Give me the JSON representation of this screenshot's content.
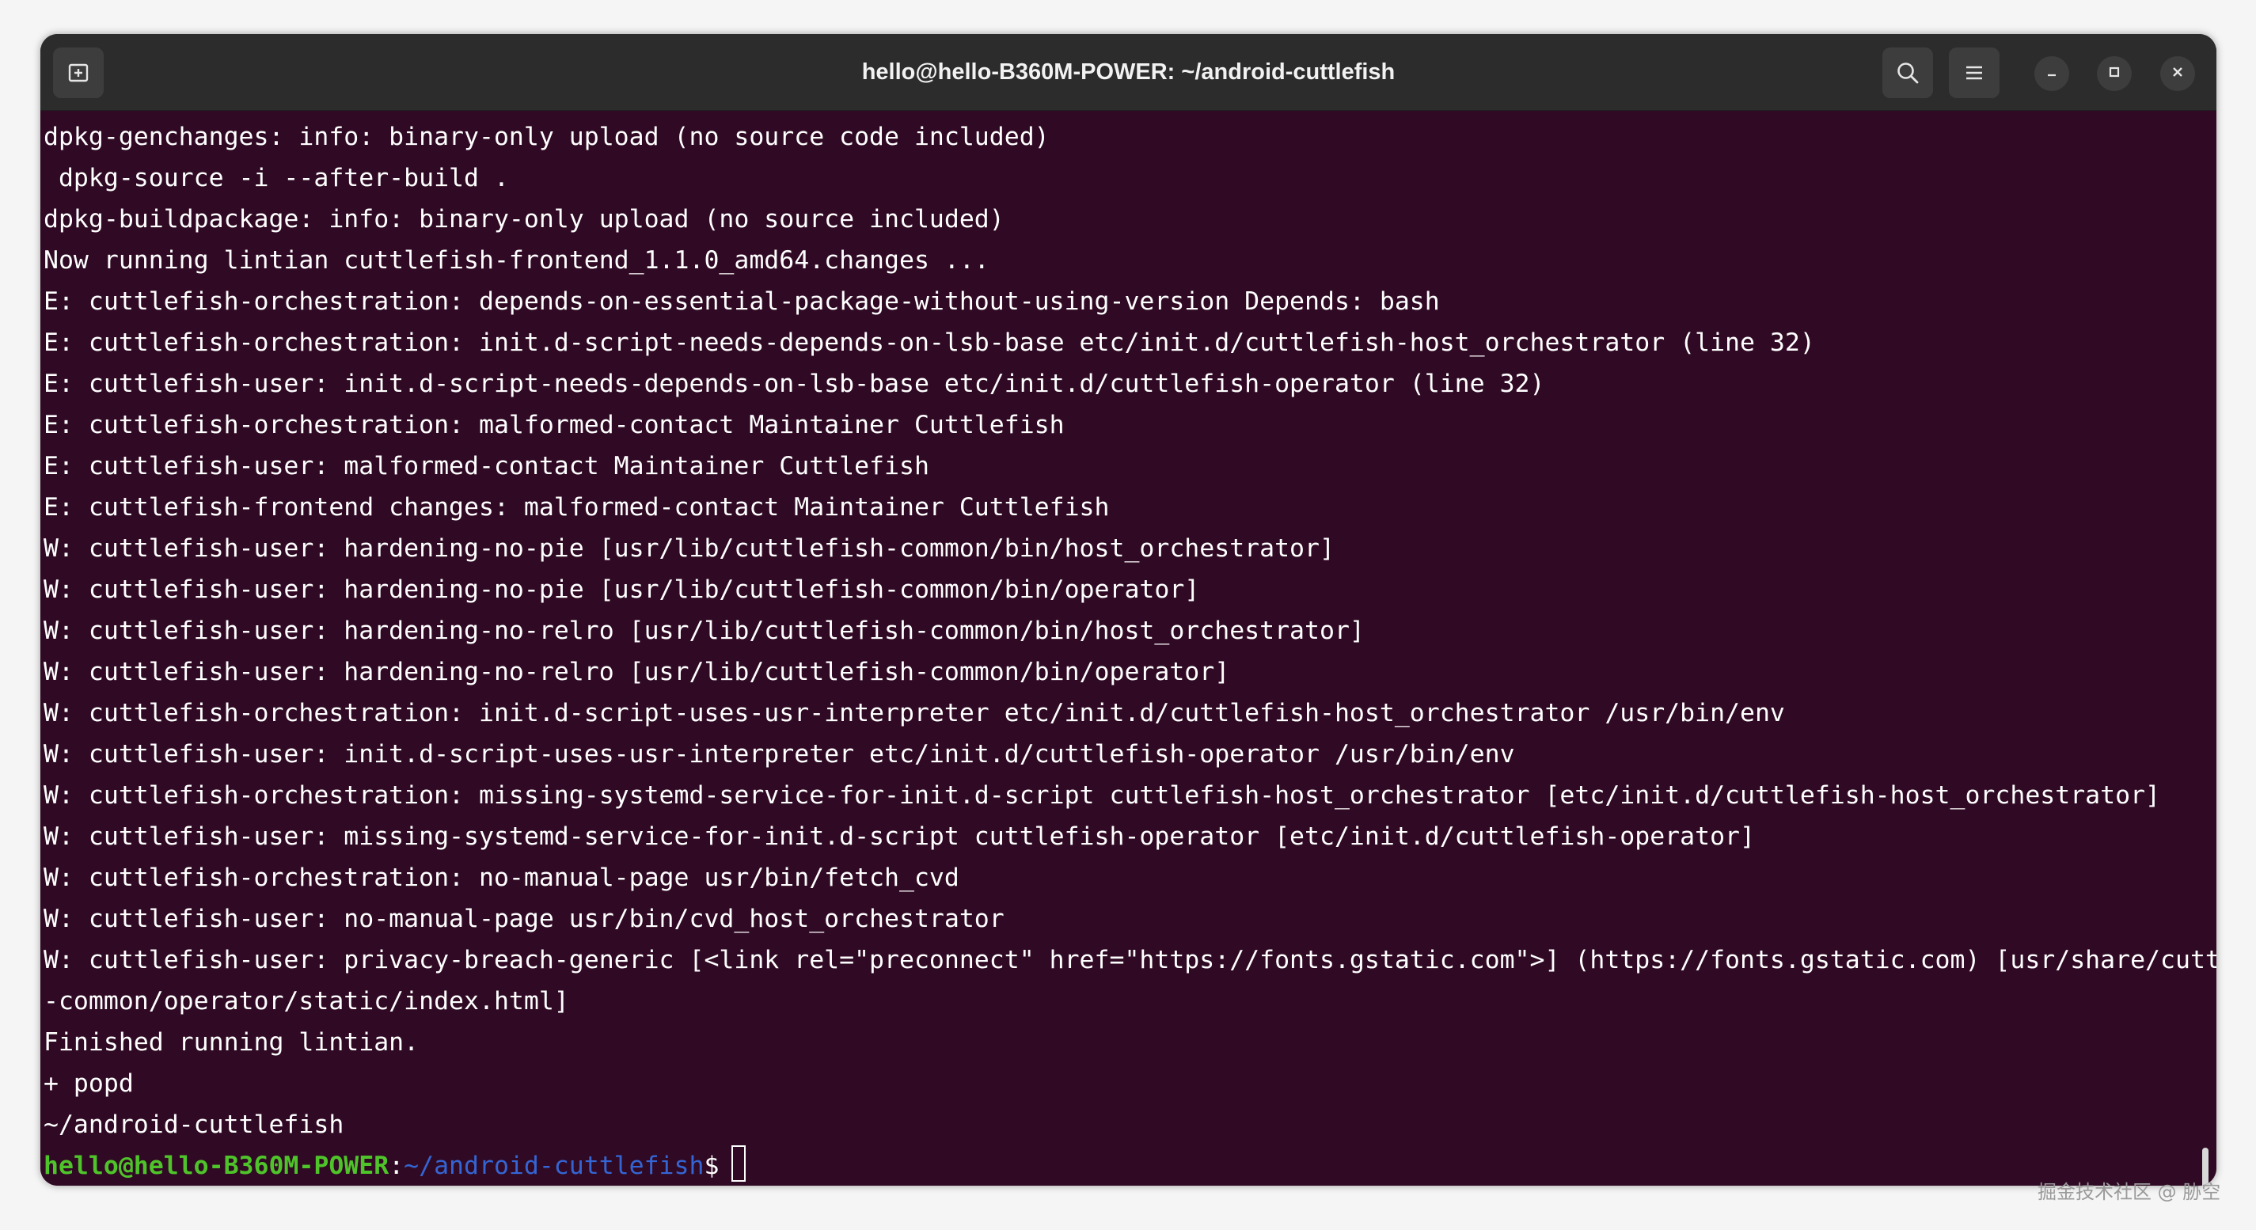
{
  "window": {
    "title": "hello@hello-B360M-POWER: ~/android-cuttlefish"
  },
  "titlebar": {
    "icons": {
      "new_tab": "new-tab-icon",
      "search": "search-icon",
      "menu": "hamburger-menu-icon",
      "minimize": "minimize-icon",
      "maximize": "maximize-icon",
      "close": "close-icon"
    }
  },
  "terminal": {
    "colors": {
      "background": "#300a24",
      "foreground": "#ffffff",
      "prompt_user": "#4fc42a",
      "prompt_path": "#3465d4"
    },
    "lines": [
      "dpkg-genchanges: info: binary-only upload (no source code included)",
      " dpkg-source -i --after-build .",
      "dpkg-buildpackage: info: binary-only upload (no source included)",
      "Now running lintian cuttlefish-frontend_1.1.0_amd64.changes ...",
      "E: cuttlefish-orchestration: depends-on-essential-package-without-using-version Depends: bash",
      "E: cuttlefish-orchestration: init.d-script-needs-depends-on-lsb-base etc/init.d/cuttlefish-host_orchestrator (line 32)",
      "E: cuttlefish-user: init.d-script-needs-depends-on-lsb-base etc/init.d/cuttlefish-operator (line 32)",
      "E: cuttlefish-orchestration: malformed-contact Maintainer Cuttlefish",
      "E: cuttlefish-user: malformed-contact Maintainer Cuttlefish",
      "E: cuttlefish-frontend changes: malformed-contact Maintainer Cuttlefish",
      "W: cuttlefish-user: hardening-no-pie [usr/lib/cuttlefish-common/bin/host_orchestrator]",
      "W: cuttlefish-user: hardening-no-pie [usr/lib/cuttlefish-common/bin/operator]",
      "W: cuttlefish-user: hardening-no-relro [usr/lib/cuttlefish-common/bin/host_orchestrator]",
      "W: cuttlefish-user: hardening-no-relro [usr/lib/cuttlefish-common/bin/operator]",
      "W: cuttlefish-orchestration: init.d-script-uses-usr-interpreter etc/init.d/cuttlefish-host_orchestrator /usr/bin/env",
      "W: cuttlefish-user: init.d-script-uses-usr-interpreter etc/init.d/cuttlefish-operator /usr/bin/env",
      "W: cuttlefish-orchestration: missing-systemd-service-for-init.d-script cuttlefish-host_orchestrator [etc/init.d/cuttlefish-host_orchestrator]",
      "W: cuttlefish-user: missing-systemd-service-for-init.d-script cuttlefish-operator [etc/init.d/cuttlefish-operator]",
      "W: cuttlefish-orchestration: no-manual-page usr/bin/fetch_cvd",
      "W: cuttlefish-user: no-manual-page usr/bin/cvd_host_orchestrator",
      "W: cuttlefish-user: privacy-breach-generic [<link rel=\"preconnect\" href=\"https://fonts.gstatic.com\">] (https://fonts.gstatic.com) [usr/share/cuttlefish",
      "-common/operator/static/index.html]",
      "Finished running lintian.",
      "+ popd",
      "~/android-cuttlefish"
    ],
    "prompt": {
      "user_host": "hello@hello-B360M-POWER",
      "colon": ":",
      "path": "~/android-cuttlefish",
      "symbol": "$"
    }
  },
  "watermark": "掘金技术社区 @ 胁空"
}
